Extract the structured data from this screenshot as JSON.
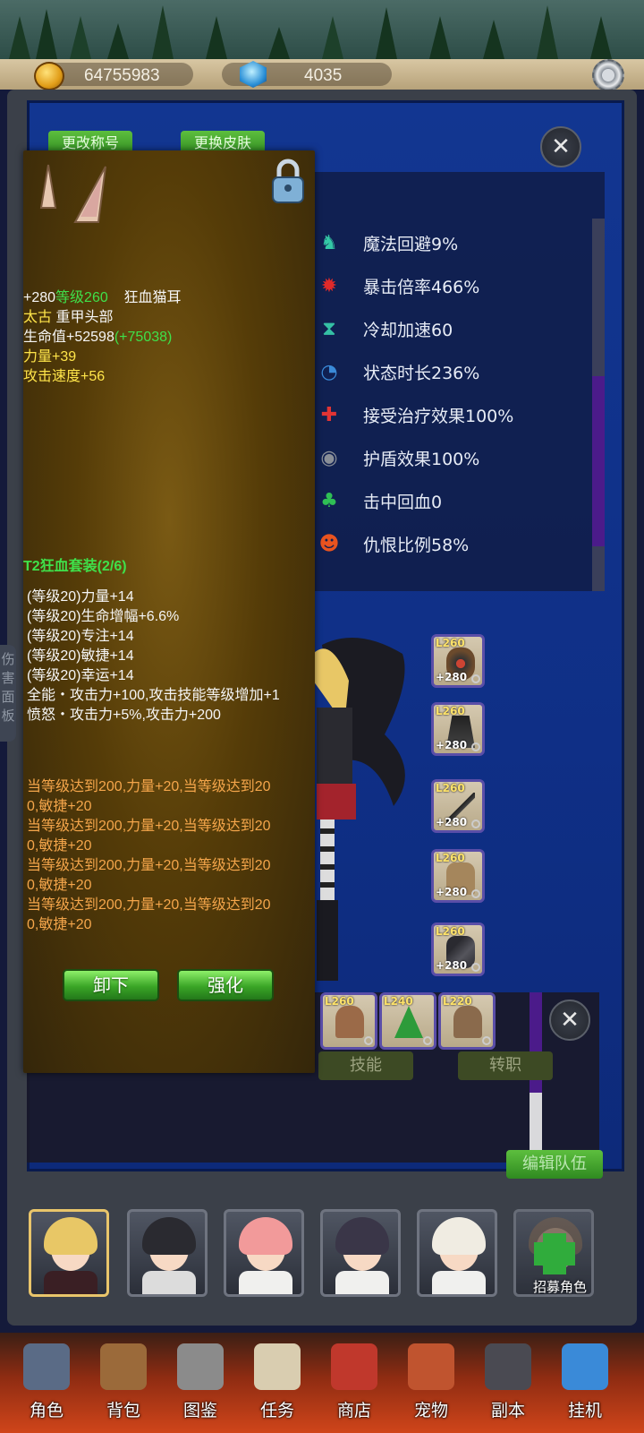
{
  "currency": {
    "gold": "64755983",
    "gems": "4035"
  },
  "header_buttons": {
    "rename": "更改称号",
    "skin": "更换皮肤"
  },
  "stats": [
    {
      "icon": "magic-evade-icon",
      "label": "魔法回避9%",
      "color": "#34c8a6"
    },
    {
      "icon": "crit-multiplier-icon",
      "label": "暴击倍率466%",
      "color": "#e02a2a"
    },
    {
      "icon": "cooldown-icon",
      "label": "冷却加速60",
      "color": "#35c0a5"
    },
    {
      "icon": "status-duration-icon",
      "label": "状态时长236%",
      "color": "#3a8ad8"
    },
    {
      "icon": "heal-received-icon",
      "label": "接受治疗效果100%",
      "color": "#e23434"
    },
    {
      "icon": "shield-effect-icon",
      "label": "护盾效果100%",
      "color": "#8a8f98"
    },
    {
      "icon": "lifesteal-icon",
      "label": "击中回血0",
      "color": "#2fbf55"
    },
    {
      "icon": "threat-icon",
      "label": "仇恨比例58%",
      "color": "#e8531f"
    }
  ],
  "equip_slots": [
    {
      "level": "L260",
      "plus": "+280"
    },
    {
      "level": "L260",
      "plus": "+280"
    },
    {
      "level": "L260",
      "plus": "+280"
    },
    {
      "level": "L260",
      "plus": "+280"
    },
    {
      "level": "L260",
      "plus": "+280"
    }
  ],
  "inventory_slots": [
    {
      "level": "L260"
    },
    {
      "level": "L240"
    },
    {
      "level": "L220"
    }
  ],
  "lower_buttons": {
    "skill": "技能",
    "job": "转职",
    "edit_team": "编辑队伍"
  },
  "side_tab": "伤害面板",
  "tooltip": {
    "line1_plus": "+280",
    "line1_level": "等级260",
    "line1_name": "狂血猫耳",
    "line2_tier": "太古",
    "line2_type": "重甲头部",
    "hp": "生命值+52598",
    "hp_bonus": "(+75038)",
    "str": "力量+39",
    "atk_speed": "攻击速度+56",
    "set_title": "T2狂血套装(2/6)",
    "set_bonuses": [
      "(等级20)力量+14",
      "(等级20)生命增幅+6.6%",
      "(等级20)专注+14",
      "(等级20)敏捷+14",
      "(等级20)幸运+14",
      "全能・攻击力+100,攻击技能等级增加+1",
      "愤怒・攻击力+5%,攻击力+200"
    ],
    "level_bonuses": [
      "当等级达到200,力量+20,当等级达到20",
      "0,敏捷+20",
      "当等级达到200,力量+20,当等级达到20",
      "0,敏捷+20",
      "当等级达到200,力量+20,当等级达到20",
      "0,敏捷+20",
      "当等级达到200,力量+20,当等级达到20",
      "0,敏捷+20"
    ],
    "unequip": "卸下",
    "enhance": "强化"
  },
  "recruit_label": "招募角色",
  "nav": [
    {
      "label": "角色",
      "icon": "helmet-icon",
      "color": "#5a6b86"
    },
    {
      "label": "背包",
      "icon": "backpack-icon",
      "color": "#9b6a3a"
    },
    {
      "label": "图鉴",
      "icon": "book-icon",
      "color": "#8b8b8b"
    },
    {
      "label": "任务",
      "icon": "scroll-icon",
      "color": "#d9cdb0"
    },
    {
      "label": "商店",
      "icon": "shop-icon",
      "color": "#c0382c"
    },
    {
      "label": "宠物",
      "icon": "pet-icon",
      "color": "#c0542f"
    },
    {
      "label": "副本",
      "icon": "dungeon-icon",
      "color": "#4a4a52"
    },
    {
      "label": "挂机",
      "icon": "calendar-icon",
      "color": "#3a8ad8"
    }
  ]
}
